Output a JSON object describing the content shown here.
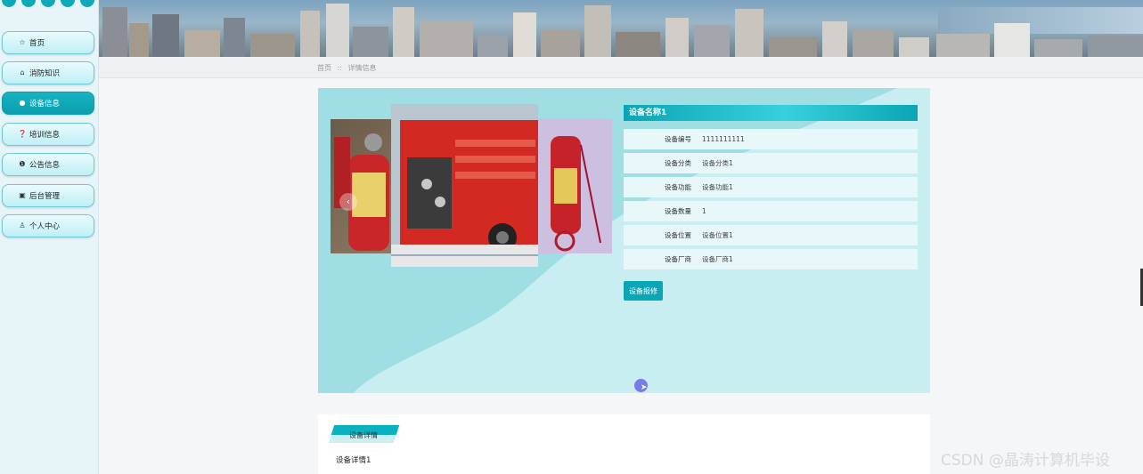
{
  "sidebar": {
    "items": [
      {
        "label": "首页",
        "icon": "star-icon",
        "active": false
      },
      {
        "label": "消防知识",
        "icon": "bag-icon",
        "active": false
      },
      {
        "label": "设备信息",
        "icon": "dot-icon",
        "active": true
      },
      {
        "label": "培训信息",
        "icon": "question-icon",
        "active": false
      },
      {
        "label": "公告信息",
        "icon": "info-icon",
        "active": false
      },
      {
        "label": "后台管理",
        "icon": "briefcase-icon",
        "active": false
      },
      {
        "label": "个人中心",
        "icon": "user-icon",
        "active": false
      }
    ]
  },
  "breadcrumb": {
    "home": "首页",
    "separator": "::",
    "current": "详情信息"
  },
  "device": {
    "name": "设备名称1",
    "fields": [
      {
        "key": "设备编号",
        "value": "1111111111"
      },
      {
        "key": "设备分类",
        "value": "设备分类1"
      },
      {
        "key": "设备功能",
        "value": "设备功能1"
      },
      {
        "key": "设备数量",
        "value": "1"
      },
      {
        "key": "设备位置",
        "value": "设备位置1"
      },
      {
        "key": "设备厂商",
        "value": "设备厂商1"
      }
    ],
    "repair_label": "设备报修"
  },
  "detail": {
    "tab_label": "设备详情",
    "content": "设备详情1"
  },
  "watermark": "CSDN @晶涛计算机毕设",
  "colors": {
    "accent": "#0aa6b5",
    "card_bg": "#9fdfe4",
    "sidebar_bg": "#e7f5f8"
  }
}
